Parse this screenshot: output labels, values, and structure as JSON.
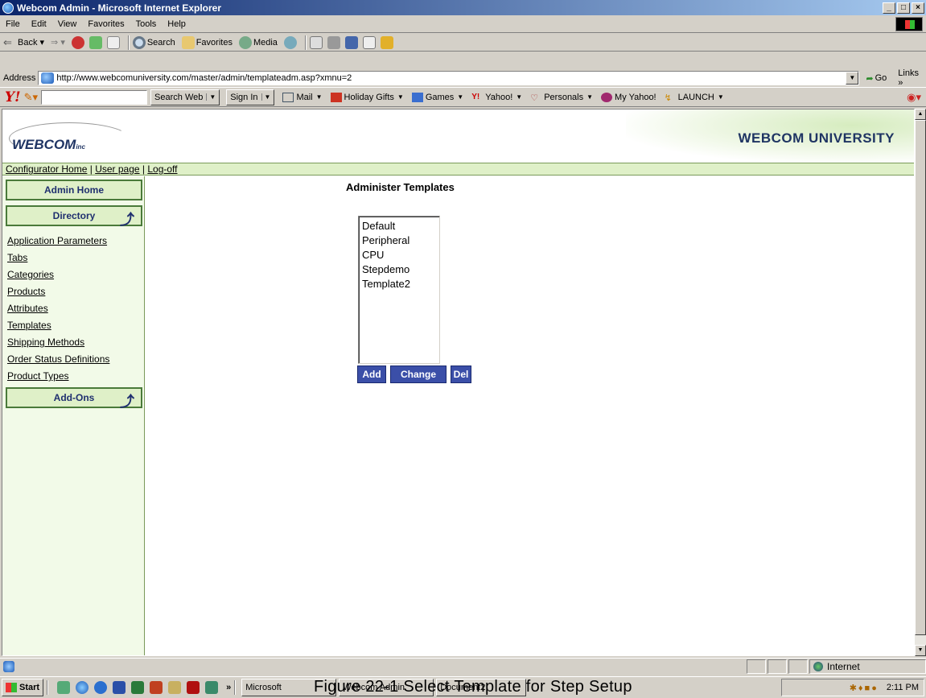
{
  "window": {
    "title": "Webcom Admin - Microsoft Internet Explorer"
  },
  "menu": [
    "File",
    "Edit",
    "View",
    "Favorites",
    "Tools",
    "Help"
  ],
  "toolbar": {
    "back": "Back",
    "search": "Search",
    "favorites": "Favorites",
    "media": "Media"
  },
  "address": {
    "label": "Address",
    "url": "http://www.webcomuniversity.com/master/admin/templateadm.asp?xmnu=2",
    "go": "Go",
    "links": "Links"
  },
  "yahoo": {
    "search_btn": "Search Web",
    "sign_in": "Sign In",
    "items": [
      "Mail",
      "Holiday Gifts",
      "Games",
      "Yahoo!",
      "Personals",
      "My Yahoo!",
      "LAUNCH"
    ]
  },
  "page": {
    "logo": "WEBCOM",
    "logo_sub": "inc",
    "university": "WEBCOM UNIVERSITY",
    "nav": {
      "home": "Configurator Home",
      "user": "User page",
      "logoff": "Log-off"
    },
    "admin_home": "Admin Home",
    "directory": "Directory",
    "addons": "Add-Ons",
    "links": [
      "Application Parameters",
      "Tabs",
      "Categories",
      "Products",
      "Attributes",
      "Templates",
      "Shipping Methods",
      "Order Status Definitions",
      "Product Types"
    ],
    "title": "Administer Templates",
    "templates": [
      "Default",
      "Peripheral",
      "CPU",
      "Stepdemo",
      "Template2"
    ],
    "buttons": {
      "add": "Add",
      "change": "Change",
      "del": "Del"
    }
  },
  "status": {
    "zone": "Internet"
  },
  "taskbar": {
    "start": "Start",
    "tasks": [
      "Microsoft",
      "Webcom Admin",
      "Document2"
    ],
    "time": "2:11 PM"
  },
  "caption": "Figure 22-1 Select Template for Step Setup"
}
